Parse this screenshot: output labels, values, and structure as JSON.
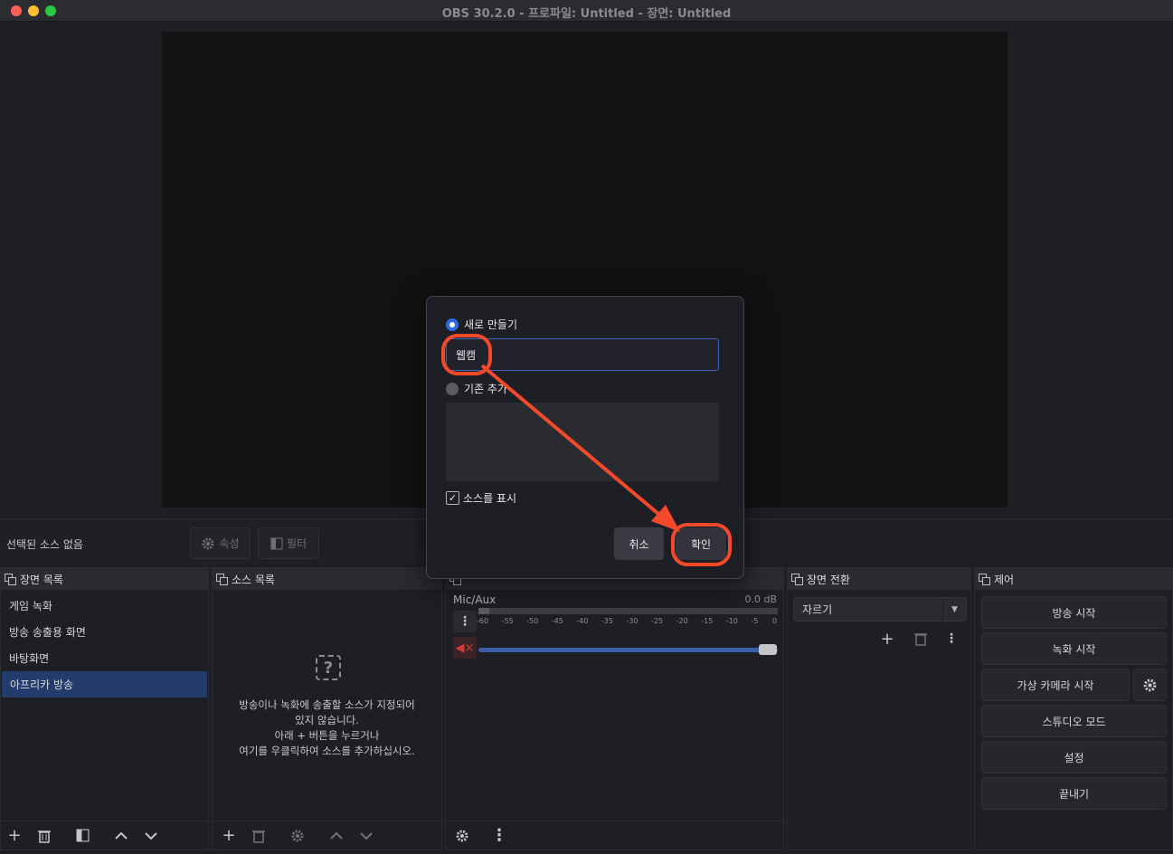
{
  "window": {
    "title": "OBS 30.2.0 - 프로파일: Untitled - 장면: Untitled"
  },
  "props_bar": {
    "no_source": "선택된 소스 없음",
    "properties_label": "속성",
    "filters_label": "필터"
  },
  "scenes": {
    "title": "장면 목록",
    "items": [
      {
        "label": "게임 녹화"
      },
      {
        "label": "방송 송출용 화면"
      },
      {
        "label": "바탕화면"
      },
      {
        "label": "아프리카 방송"
      }
    ],
    "selected_index": 3
  },
  "sources": {
    "title": "소스 목록",
    "empty_line1": "방송이나 녹화에 송출할 소스가 지정되어",
    "empty_line2": "있지 않습니다.",
    "empty_line3": "아래 + 버튼을 누르거나",
    "empty_line4": "여기를 우클릭하여 소스를 추가하십시오."
  },
  "mixer": {
    "channel": "Mic/Aux",
    "db": "0.0 dB",
    "ticks": [
      "-60",
      "-55",
      "-50",
      "-45",
      "-40",
      "-35",
      "-30",
      "-25",
      "-20",
      "-15",
      "-10",
      "-5",
      "0"
    ],
    "volume_level": 1.0
  },
  "transitions": {
    "title": "장면 전환",
    "selected": "자르기"
  },
  "controls": {
    "title": "제어",
    "start_stream": "방송 시작",
    "start_record": "녹화 시작",
    "start_virtualcam": "가상 카메라 시작",
    "studio_mode": "스튜디오 모드",
    "settings": "설정",
    "exit": "끝내기"
  },
  "dialog": {
    "create_new_label": "새로 만들기",
    "name_value": "웹캠",
    "add_existing_label": "기존 추가",
    "visible_label": "소스를 표시",
    "visible_checked": true,
    "cancel_label": "취소",
    "ok_label": "확인"
  },
  "colors": {
    "annotation": "#f2492a",
    "accent": "#2f6ae1",
    "selected": "#233c6b"
  }
}
